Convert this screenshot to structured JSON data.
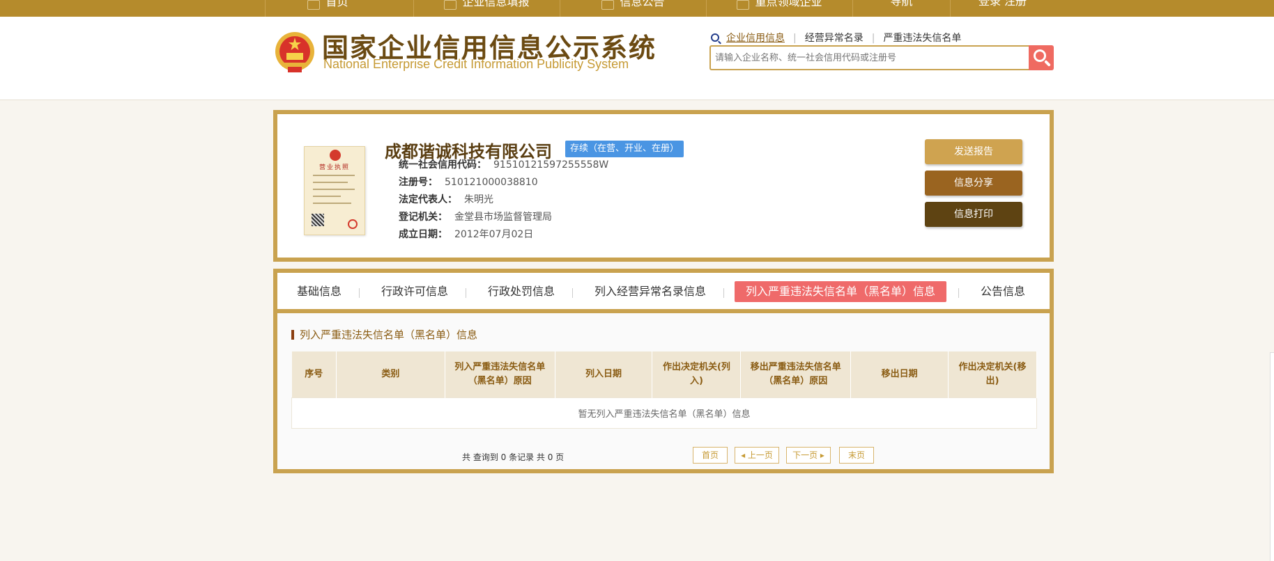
{
  "topnav": {
    "items": [
      "首页",
      "企业信息填报",
      "信息公告",
      "重点领域企业",
      "导航",
      "登录 注册"
    ]
  },
  "header": {
    "title_cn": "国家企业信用信息公示系统",
    "title_en": "National Enterprise Credit Information Publicity System",
    "search_tabs": [
      "企业信用信息",
      "经营异常名录",
      "严重违法失信名单"
    ],
    "search_placeholder": "请输入企业名称、统一社会信用代码或注册号"
  },
  "company": {
    "name": "成都谐诚科技有限公司",
    "status": "存续（在营、开业、在册）",
    "cert_title": "营业执照",
    "fields": [
      {
        "label": "统一社会信用代码：",
        "value": "91510121597255558W"
      },
      {
        "label": "注册号：",
        "value": "510121000038810"
      },
      {
        "label": "法定代表人：",
        "value": "朱明光"
      },
      {
        "label": "登记机关：",
        "value": "金堂县市场监督管理局"
      },
      {
        "label": "成立日期：",
        "value": "2012年07月02日"
      }
    ],
    "actions": [
      "发送报告",
      "信息分享",
      "信息打印"
    ]
  },
  "tabs": [
    "基础信息",
    "行政许可信息",
    "行政处罚信息",
    "列入经营异常名录信息",
    "列入严重违法失信名单（黑名单）信息",
    "公告信息"
  ],
  "active_tab": "列入严重违法失信名单（黑名单）信息",
  "section": {
    "title": "列入严重违法失信名单（黑名单）信息",
    "columns": [
      "序号",
      "类别",
      "列入严重违法失信名单（黑名单）原因",
      "列入日期",
      "作出决定机关(列入)",
      "移出严重违法失信名单（黑名单）原因",
      "移出日期",
      "作出决定机关(移出)"
    ],
    "empty_text": "暂无列入严重违法失信名单（黑名单）信息",
    "pager_count": "共 查询到 0 条记录 共 0 页",
    "pager_buttons": [
      "首页",
      "上一页",
      "下一页",
      "末页"
    ]
  },
  "colors": {
    "brand_gold": "#c9a24f",
    "nav_gold": "#b58b2c",
    "active_tab": "#ef6a6a",
    "status_blue": "#4a95e3",
    "btn_send": "#cfa350",
    "btn_share": "#9a6420",
    "btn_print": "#5e4312"
  },
  "icons": [
    "national-emblem-icon",
    "search-icon",
    "business-license-image"
  ]
}
